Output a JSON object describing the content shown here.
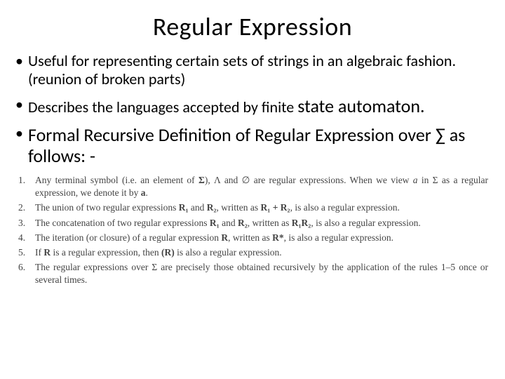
{
  "title": "Regular Expression",
  "bullets": {
    "b1": "Useful for representing certain sets of strings in an algebraic fashion. (reunion of broken parts)",
    "b2_small": "Describes the languages accepted by finite ",
    "b2_big": "state automaton.",
    "b3": "Formal Recursive Definition of Regular Expression over ∑ as follows: -"
  },
  "defs": {
    "d1_a": "Any terminal symbol (i.e. an element of ",
    "d1_b": "), Λ and ",
    "d1_empty": "∅",
    "d1_c": " are regular expressions. When we view ",
    "d1_d": " in Σ as a regular expression, we denote it by ",
    "d1_e": ".",
    "d2_a": "The union of two regular expressions ",
    "d2_b": " and ",
    "d2_c": ", written as ",
    "d2_d": ", is also a regular expression.",
    "d3_a": "The concatenation of two regular expressions ",
    "d3_b": " and ",
    "d3_c": ", written as ",
    "d3_d": ", is also a regular expression.",
    "d4_a": "The iteration (or closure) of a regular expression ",
    "d4_b": ", written as ",
    "d4_c": ", is also a regular expression.",
    "d5_a": "If ",
    "d5_b": " is a regular expression, then ",
    "d5_c": " is also a regular expression.",
    "d6_a": "The regular expressions over Σ are precisely those obtained recursively by the application of the rules 1–5 once or several times.",
    "sym": {
      "Sigma": "Σ",
      "a_i": "a",
      "a_b": "a",
      "R": "R",
      "R1": "R₁",
      "R2": "R₂",
      "R1pR2": "R₁ + R₂",
      "R1R2": "R₁R₂",
      "Rstar": "R*",
      "paren": "(R)"
    }
  }
}
